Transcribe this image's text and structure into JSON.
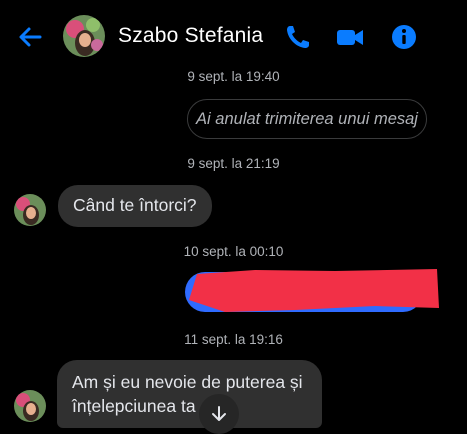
{
  "header": {
    "contact_name": "Szabo Stefania",
    "icons": [
      "back-arrow-icon",
      "phone-icon",
      "video-call-icon",
      "info-icon"
    ],
    "accent_color": "#0a7cff"
  },
  "messages": [
    {
      "type": "timestamp",
      "text": "9 sept. la 19:40"
    },
    {
      "type": "outgoing-unsent",
      "text": "Ai anulat trimiterea unui mesaj"
    },
    {
      "type": "timestamp",
      "text": "9 sept. la 21:19"
    },
    {
      "type": "incoming",
      "text": "Când te întorci?"
    },
    {
      "type": "timestamp",
      "text": "10 sept. la 00:10"
    },
    {
      "type": "outgoing-redacted"
    },
    {
      "type": "timestamp",
      "text": "11 sept. la 19:16"
    },
    {
      "type": "incoming",
      "line1": "Am și eu nevoie de puterea și",
      "line2": "înțelepciunea ta"
    }
  ],
  "colors": {
    "background": "#000000",
    "incoming_bubble": "#303030",
    "redaction": "#f23047"
  }
}
